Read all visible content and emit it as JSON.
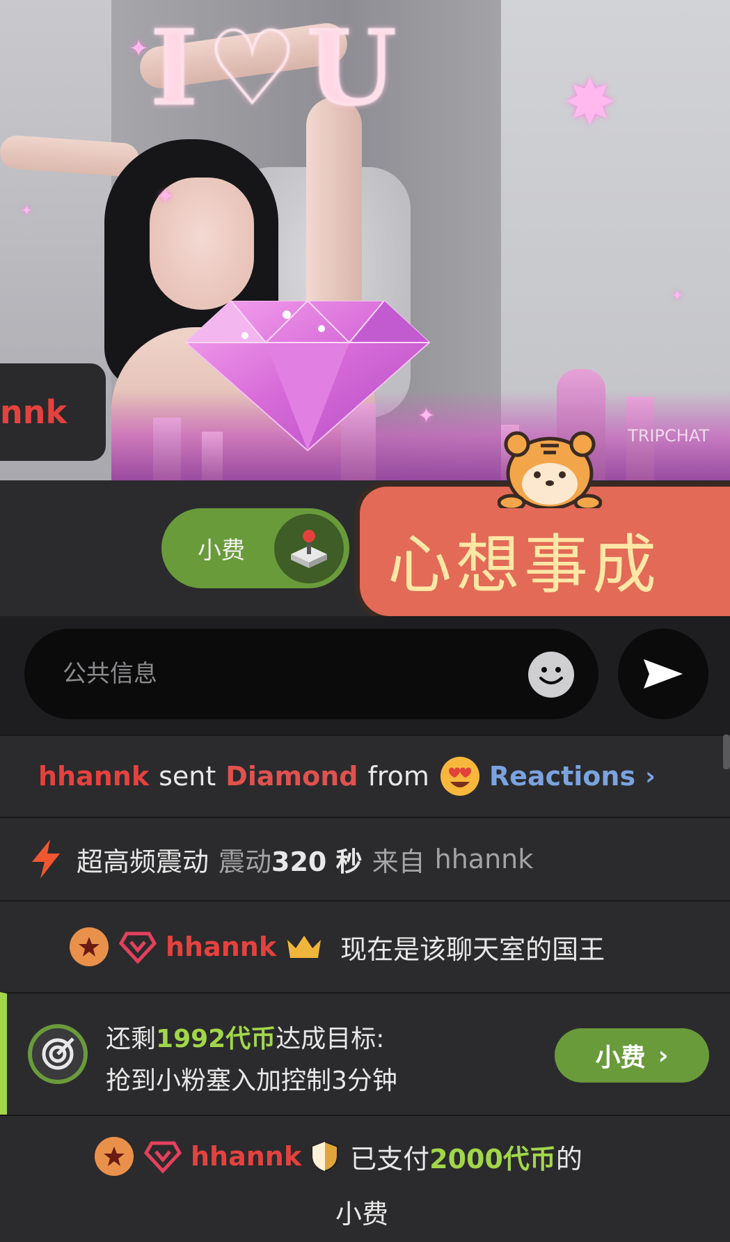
{
  "video": {
    "username_tag": "nnk",
    "watermark": "TRIPCHAT"
  },
  "tip_bar": {
    "tip_label": "小费",
    "sticker_text": "心想事成"
  },
  "input": {
    "placeholder": "公共信息"
  },
  "chat": {
    "gift": {
      "user": "hhannk",
      "verb": "sent",
      "item": "Diamond",
      "from": "from",
      "source": "Reactions"
    },
    "vibe": {
      "title": "超高频震动",
      "label": "震动",
      "duration": "320 秒",
      "from": "来自",
      "user": "hhannk"
    },
    "king": {
      "user": "hhannk",
      "text": "现在是该聊天室的国王"
    },
    "goal": {
      "prefix": "还剩",
      "amount": "1992代币",
      "suffix": "达成目标:",
      "description": "抢到小粉塞入加控制3分钟",
      "button": "小费"
    },
    "paid": {
      "user": "hhannk",
      "prefix": "已支付",
      "amount": "2000代币",
      "suffix": "的",
      "tail": "小费"
    }
  },
  "colors": {
    "username": "#e5423f",
    "accent_green": "#a2d64a",
    "tip_green": "#6a9b3b",
    "link_blue": "#7aa3e0",
    "background": "#2b2b2d"
  }
}
